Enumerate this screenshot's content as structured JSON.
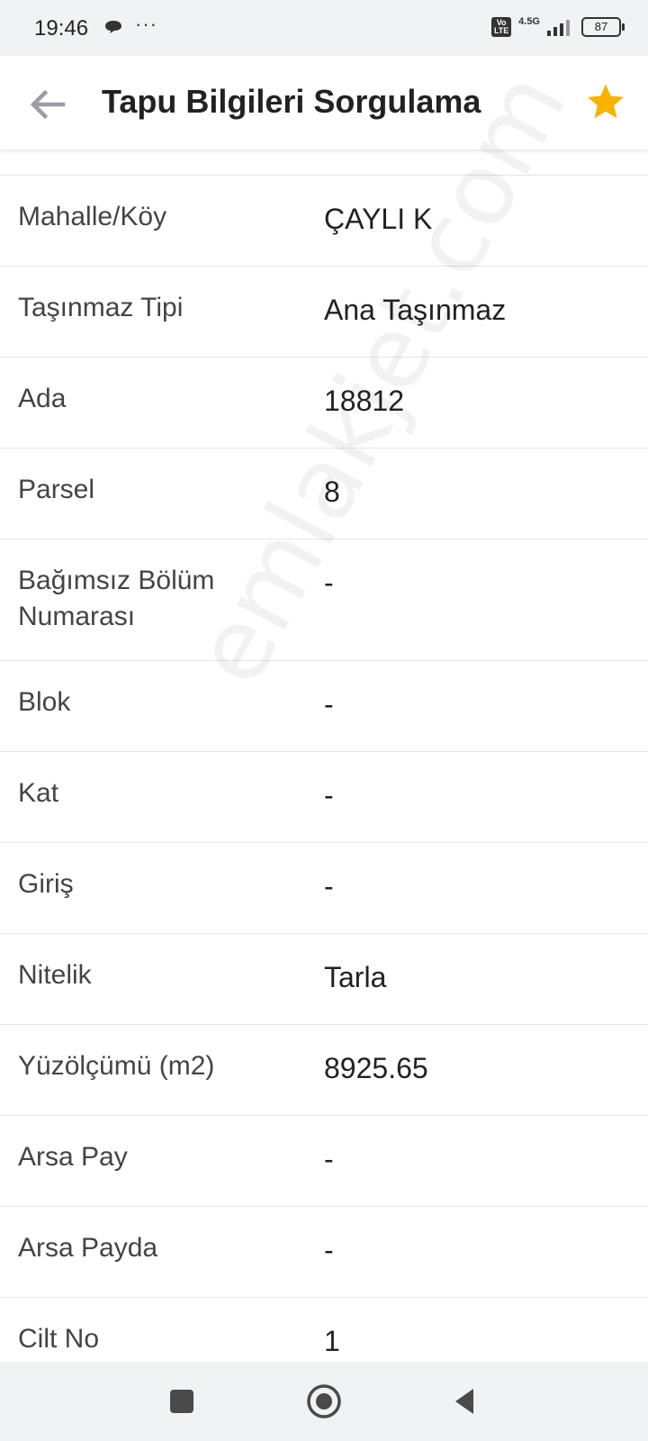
{
  "status_bar": {
    "time": "19:46",
    "dots": "···",
    "network": "4.5G",
    "volte": "Vo LTE",
    "battery": "87"
  },
  "app_bar": {
    "title": "Tapu Bilgileri Sorgulama",
    "back_icon": "arrow-left-icon",
    "star_icon": "star-icon",
    "star_color": "#f6b400"
  },
  "rows": [
    {
      "label": "Mahalle/Köy",
      "value": "ÇAYLI K"
    },
    {
      "label": "Taşınmaz Tipi",
      "value": "Ana Taşınmaz"
    },
    {
      "label": "Ada",
      "value": "18812"
    },
    {
      "label": "Parsel",
      "value": "8"
    },
    {
      "label": "Bağımsız Bölüm Numarası",
      "value": "-"
    },
    {
      "label": "Blok",
      "value": "-"
    },
    {
      "label": "Kat",
      "value": "-"
    },
    {
      "label": "Giriş",
      "value": "-"
    },
    {
      "label": "Nitelik",
      "value": "Tarla"
    },
    {
      "label": "Yüzölçümü (m2)",
      "value": "8925.65"
    },
    {
      "label": "Arsa Pay",
      "value": "-"
    },
    {
      "label": "Arsa Payda",
      "value": "-"
    },
    {
      "label": "Cilt No",
      "value": "1"
    }
  ],
  "watermark": "emlakjet.com",
  "nav_bar": {
    "recents_icon": "square-icon",
    "home_icon": "circle-home-icon",
    "back_icon": "triangle-back-icon"
  }
}
